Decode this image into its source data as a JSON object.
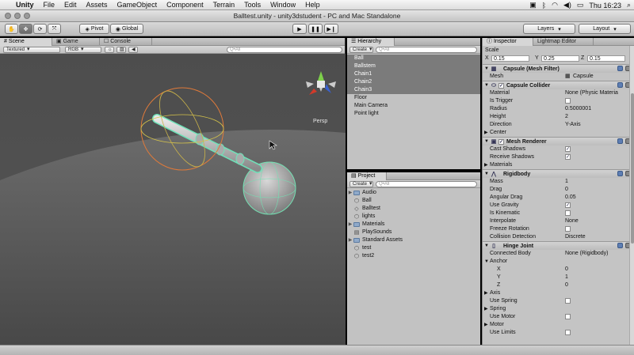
{
  "menubar": {
    "apple": "",
    "app": "Unity",
    "items": [
      "File",
      "Edit",
      "Assets",
      "GameObject",
      "Component",
      "Terrain",
      "Tools",
      "Window",
      "Help"
    ],
    "clock": "Thu 16:23"
  },
  "window": {
    "title": "Balltest.unity - unity3dstudent - PC and Mac Standalone"
  },
  "toolbar": {
    "pivot": "Pivot",
    "global": "Global",
    "layers": "Layers",
    "layout": "Layout"
  },
  "scene": {
    "tabs": [
      "Scene",
      "Game",
      "Console"
    ],
    "render_mode": "Textured",
    "color_mode": "RGB",
    "search_placeholder": "Q•All",
    "gizmo_label": "Persp"
  },
  "hierarchy": {
    "tab": "Hierarchy",
    "create": "Create",
    "search_placeholder": "Q•All",
    "items": [
      {
        "label": "Ball",
        "selected": true
      },
      {
        "label": "Ballstem",
        "selected": true
      },
      {
        "label": "Chain1",
        "selected": true
      },
      {
        "label": "Chain2",
        "selected": true
      },
      {
        "label": "Chain3",
        "selected": true
      },
      {
        "label": "Floor",
        "selected": false
      },
      {
        "label": "Main Camera",
        "selected": false
      },
      {
        "label": "Point light",
        "selected": false
      }
    ]
  },
  "project": {
    "tab": "Project",
    "create": "Create",
    "search_placeholder": "Q•All",
    "items": [
      {
        "label": "Audio",
        "kind": "folder",
        "expand": true
      },
      {
        "label": "Ball",
        "kind": "prefab",
        "expand": false
      },
      {
        "label": "Balltest",
        "kind": "scene",
        "expand": false
      },
      {
        "label": "lights",
        "kind": "prefab",
        "expand": false
      },
      {
        "label": "Materials",
        "kind": "folder",
        "expand": true
      },
      {
        "label": "PlaySounds",
        "kind": "script",
        "expand": false
      },
      {
        "label": "Standard Assets",
        "kind": "folder",
        "expand": true
      },
      {
        "label": "test",
        "kind": "prefab",
        "expand": false
      },
      {
        "label": "test2",
        "kind": "prefab",
        "expand": false
      }
    ]
  },
  "inspector": {
    "tabs": [
      "Inspector",
      "Lightmap Editor"
    ],
    "scale_label": "Scale",
    "scale": {
      "x": "0.15",
      "y": "0.25",
      "z": "0.15"
    },
    "mesh_filter": {
      "title": "Capsule (Mesh Filter)",
      "mesh_label": "Mesh",
      "mesh_value": "Capsule"
    },
    "capsule_collider": {
      "title": "Capsule Collider",
      "rows": [
        {
          "label": "Material",
          "value": "None (Physic Materia"
        },
        {
          "label": "Is Trigger",
          "check": false
        },
        {
          "label": "Radius",
          "value": "0.5000001"
        },
        {
          "label": "Height",
          "value": "2"
        },
        {
          "label": "Direction",
          "value": "Y-Axis"
        },
        {
          "label": "Center",
          "foldout": true
        }
      ]
    },
    "mesh_renderer": {
      "title": "Mesh Renderer",
      "rows": [
        {
          "label": "Cast Shadows",
          "check": true
        },
        {
          "label": "Receive Shadows",
          "check": true
        },
        {
          "label": "Materials",
          "foldout": true
        }
      ]
    },
    "rigidbody": {
      "title": "Rigidbody",
      "rows": [
        {
          "label": "Mass",
          "value": "1"
        },
        {
          "label": "Drag",
          "value": "0"
        },
        {
          "label": "Angular Drag",
          "value": "0.05"
        },
        {
          "label": "Use Gravity",
          "check": true
        },
        {
          "label": "Is Kinematic",
          "check": false
        },
        {
          "label": "Interpolate",
          "value": "None"
        },
        {
          "label": "Freeze Rotation",
          "check": false
        },
        {
          "label": "Collision Detection",
          "value": "Discrete"
        }
      ]
    },
    "hinge_joint": {
      "title": "Hinge Joint",
      "rows": [
        {
          "label": "Connected Body",
          "value": "None (Rigidbody)"
        },
        {
          "label": "Anchor",
          "foldout": true,
          "open": true
        },
        {
          "label": "X",
          "value": "0",
          "indent": true
        },
        {
          "label": "Y",
          "value": "1",
          "indent": true
        },
        {
          "label": "Z",
          "value": "0",
          "indent": true
        },
        {
          "label": "Axis",
          "foldout": true
        },
        {
          "label": "Use Spring",
          "check": false
        },
        {
          "label": "Spring",
          "foldout": true
        },
        {
          "label": "Use Motor",
          "check": false
        },
        {
          "label": "Motor",
          "foldout": true
        },
        {
          "label": "Use Limits",
          "check": false
        }
      ]
    }
  }
}
